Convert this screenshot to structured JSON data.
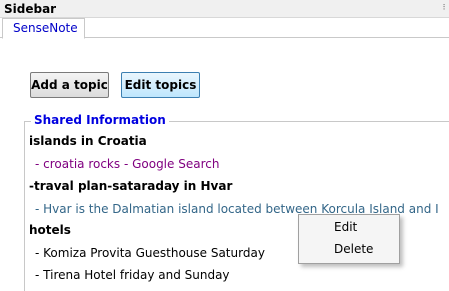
{
  "window": {
    "title": "Sidebar",
    "close_glyph": "⁝"
  },
  "tabs": [
    {
      "label": "SenseNote"
    }
  ],
  "toolbar": {
    "add_label": "Add a topic",
    "edit_label": "Edit topics"
  },
  "group": {
    "legend": "Shared Information"
  },
  "notes": [
    {
      "kind": "topic",
      "text": "islands in Croatia"
    },
    {
      "kind": "link",
      "text": "- croatia rocks - Google Search"
    },
    {
      "kind": "topic",
      "text": "-traval plan-sataraday in Hvar"
    },
    {
      "kind": "link",
      "text": "- Hvar is the Dalmatian island located between Korcula Island and I"
    },
    {
      "kind": "topic",
      "text": "hotels"
    },
    {
      "kind": "item",
      "text": "- Komiza Provita Guesthouse Saturday"
    },
    {
      "kind": "item",
      "text": "- Tirena Hotel friday and Sunday"
    }
  ],
  "context_menu": {
    "edit_label": "Edit",
    "delete_label": "Delete"
  }
}
